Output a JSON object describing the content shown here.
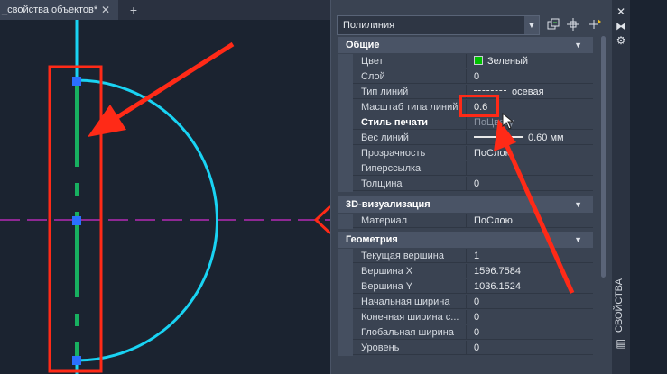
{
  "tab": {
    "title": "_свойства объектов*",
    "close": "✕",
    "add": "+"
  },
  "panel": {
    "object_type": "Полилиния",
    "sections": {
      "general": "Общие",
      "viz3d": "3D-визуализация",
      "geometry": "Геометрия"
    },
    "rows": {
      "color": {
        "label": "Цвет",
        "value": "Зеленый"
      },
      "layer": {
        "label": "Слой",
        "value": "0"
      },
      "linetype": {
        "label": "Тип линий",
        "value": "осевая"
      },
      "ltscale": {
        "label": "Масштаб типа линий",
        "value": "0.6"
      },
      "plotstyle": {
        "label": "Стиль печати",
        "value": "ПоЦвету"
      },
      "lineweight": {
        "label": "Вес линий",
        "value": "0.60 мм"
      },
      "transparency": {
        "label": "Прозрачность",
        "value": "ПоСлою"
      },
      "hyperlink": {
        "label": "Гиперссылка",
        "value": ""
      },
      "thickness": {
        "label": "Толщина",
        "value": "0"
      },
      "material": {
        "label": "Материал",
        "value": "ПоСлою"
      },
      "curvertex": {
        "label": "Текущая вершина",
        "value": "1"
      },
      "vertexx": {
        "label": "Вершина X",
        "value": "1596.7584"
      },
      "vertexy": {
        "label": "Вершина Y",
        "value": "1036.1524"
      },
      "startw": {
        "label": "Начальная ширина",
        "value": "0"
      },
      "endw": {
        "label": "Конечная ширина с...",
        "value": "0"
      },
      "globalw": {
        "label": "Глобальная ширина",
        "value": "0"
      },
      "elev": {
        "label": "Уровень",
        "value": "0"
      }
    },
    "side_title": "СВОЙСТВА",
    "strip_icons": [
      "close-icon",
      "autohide-icon",
      "settings-icon",
      "properties-icon"
    ]
  },
  "colors": {
    "background": "#1b2330",
    "circle": "#19d3f3",
    "polyline": "#18b060",
    "centerline": "#b42ab4",
    "annotation": "#ff2a17",
    "grip": "#2b6fff",
    "swatch": "#00c000"
  }
}
